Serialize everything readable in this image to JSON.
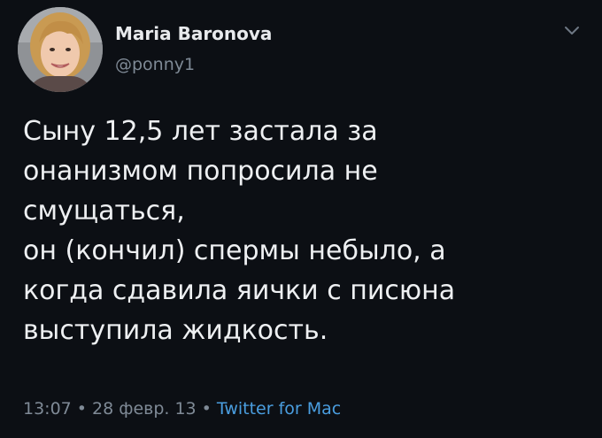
{
  "author": {
    "name": "Maria Baronova",
    "handle": "@ponny1"
  },
  "tweet": {
    "lines": [
      "Сыну 12,5 лет застала за",
      "онанизмом попросила не",
      "смущаться,",
      "он (кончил) спермы небыло, а",
      "когда сдавила яички с писюна",
      "выступила жидкость."
    ]
  },
  "meta": {
    "time": "13:07",
    "separator": "•",
    "date": "28 февр. 13",
    "source": "Twitter for Mac"
  },
  "colors": {
    "background": "#0c0f14",
    "text": "#eef0f2",
    "muted": "#7f8a96",
    "link": "#4a9ee0"
  },
  "icons": {
    "menu": "chevron-down-icon"
  }
}
